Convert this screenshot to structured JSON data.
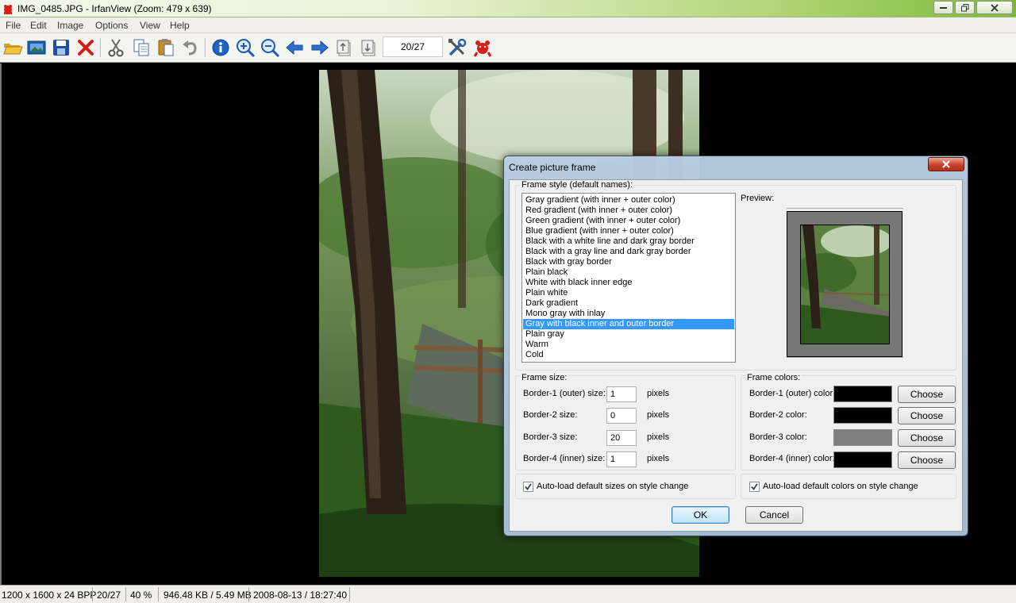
{
  "window": {
    "title": "IMG_0485.JPG - IrfanView (Zoom: 479 x 639)"
  },
  "menu": [
    "File",
    "Edit",
    "Image",
    "Options",
    "View",
    "Help"
  ],
  "toolbar": {
    "page_counter": "20/27",
    "icons": [
      "open-folder-icon",
      "slideshow-icon",
      "save-icon",
      "delete-icon",
      "cut-icon",
      "copy-icon",
      "paste-icon",
      "undo-icon",
      "info-icon",
      "zoom-in-icon",
      "zoom-out-icon",
      "previous-icon",
      "next-icon",
      "first-page-icon",
      "last-page-icon",
      "properties-icon",
      "irfanview-logo-icon"
    ]
  },
  "status": {
    "dimensions": "1200 x 1600 x 24 BPP",
    "index": "20/27",
    "zoom": "40 %",
    "size": "946.48 KB / 5.49 MB",
    "datetime": "2008-08-13 / 18:27:40"
  },
  "dialog": {
    "title": "Create picture frame",
    "frame_style_label": "Frame style (default names):",
    "styles": [
      "Gray gradient (with inner + outer color)",
      "Red gradient (with inner + outer color)",
      "Green gradient (with inner + outer color)",
      "Blue gradient (with inner + outer color)",
      "Black with a white line and dark gray border",
      "Black with a gray line and dark gray border",
      "Black with gray border",
      "Plain black",
      "White with black inner edge",
      "Plain white",
      "Dark gradient",
      "Mono gray with inlay",
      "Gray with black inner and outer border",
      "Plain gray",
      "Warm",
      "Cold"
    ],
    "selected_style_index": 12,
    "preview_label": "Preview:",
    "frame_size": {
      "label": "Frame size:",
      "unit": "pixels",
      "fields": [
        {
          "label": "Border-1 (outer) size:",
          "value": "1"
        },
        {
          "label": "Border-2 size:",
          "value": "0"
        },
        {
          "label": "Border-3 size:",
          "value": "20"
        },
        {
          "label": "Border-4 (inner) size:",
          "value": "1"
        }
      ],
      "autoload_label": "Auto-load default sizes on style change",
      "autoload_checked": true
    },
    "frame_colors": {
      "label": "Frame colors:",
      "choose_label": "Choose",
      "fields": [
        {
          "label": "Border-1 (outer) color:",
          "color": "#000000"
        },
        {
          "label": "Border-2 color:",
          "color": "#000000"
        },
        {
          "label": "Border-3 color:",
          "color": "#808080"
        },
        {
          "label": "Border-4 (inner) color:",
          "color": "#000000"
        }
      ],
      "autoload_label": "Auto-load default colors on style change",
      "autoload_checked": true
    },
    "ok_label": "OK",
    "cancel_label": "Cancel"
  },
  "colors": {
    "selection": "#3399ff",
    "title_gradient_end": "#7cb93a"
  }
}
